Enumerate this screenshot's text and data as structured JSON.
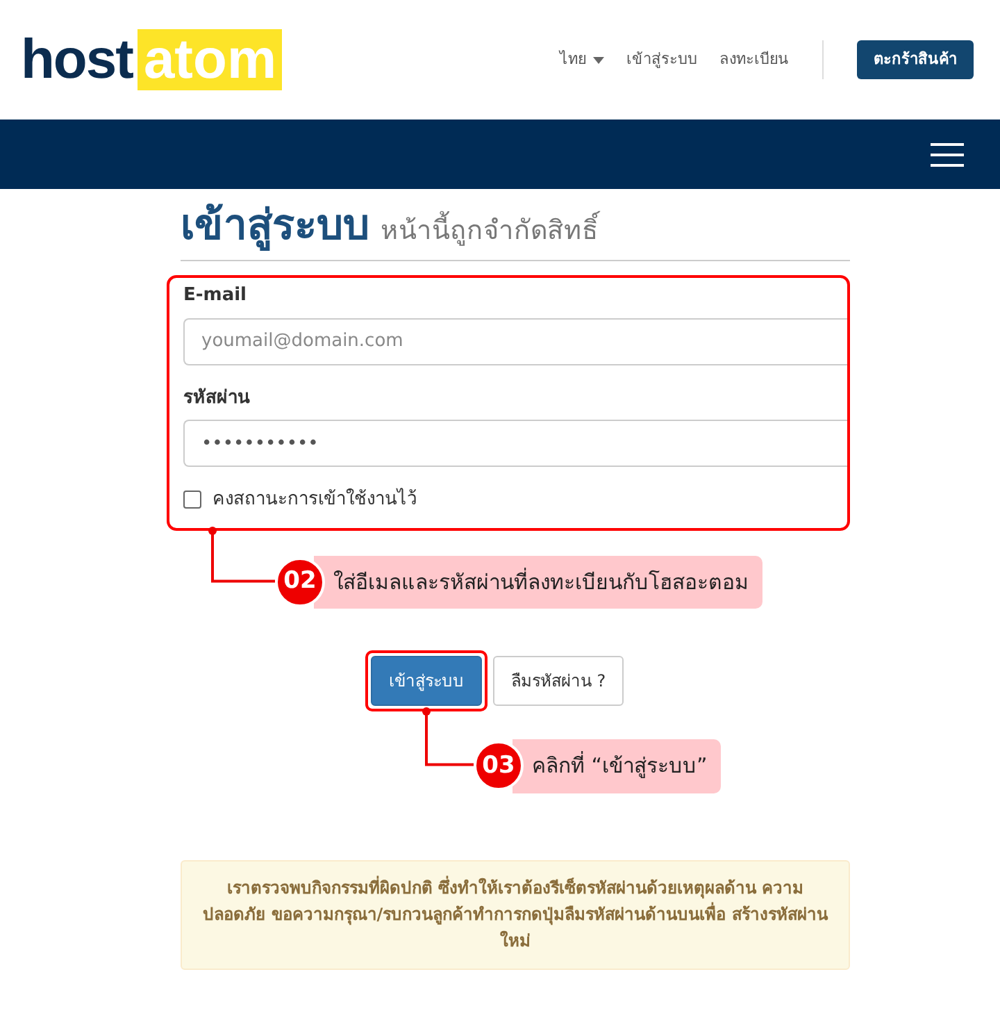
{
  "logo": {
    "part_1": "host",
    "part_2": "atom"
  },
  "top_nav": [
    {
      "label": "ไทย",
      "kind": "dropdown"
    },
    {
      "label": "เข้าสู่ระบบ",
      "kind": "link"
    },
    {
      "label": "ลงทะเบียน",
      "kind": "link"
    }
  ],
  "cart_button": "ตะกร้าสินค้า",
  "heading": {
    "title": "เข้าสู่ระบบ",
    "subtitle": "หน้านี้ถูกจำกัดสิทธิ์"
  },
  "fields": [
    {
      "label": "E-mail",
      "placeholder": "youmail@domain.com"
    },
    {
      "label": "รหัสผ่าน",
      "value": "•••••••••••"
    }
  ],
  "remember": {
    "label": "คงสถานะการเข้าใช้งานไว้",
    "checked": false
  },
  "buttons": [
    {
      "label": "เข้าสู่ระบบ",
      "kind": "primary"
    },
    {
      "label": "ลืมรหัสผ่าน ?",
      "kind": "secondary"
    }
  ],
  "callouts": [
    {
      "number": "02",
      "text": "ใส่อีเมลและรหัสผ่านที่ลงทะเบียนกับโฮสอะตอม"
    },
    {
      "number": "03",
      "text": "คลิกที่  “เข้าสู่ระบบ”"
    }
  ],
  "alert": "เราตรวจพบกิจกรรมที่ผิดปกติ ซึ่งทำให้เราต้องรีเซ็ตรหัสผ่านด้วยเหตุผลด้าน ความปลอดภัย ขอความกรุณา/รบกวนลูกค้าทำการกดปุ่มลืมรหัสผ่านด้านบนเพื่อ สร้างรหัสผ่านใหม่"
}
